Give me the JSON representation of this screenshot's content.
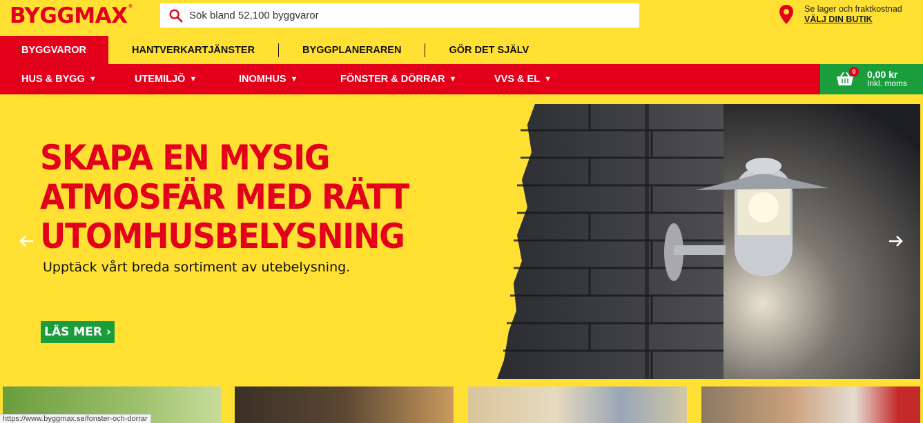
{
  "header": {
    "logo": "BYGGMAX",
    "search_placeholder": "Sök bland 52,100 byggvaror",
    "store": {
      "line1": "Se lager och fraktkostnad",
      "cta": "VÄLJ DIN BUTIK"
    }
  },
  "tabs": [
    "BYGGVAROR",
    "HANTVERKARTJÄNSTER",
    "BYGGPLANERAREN",
    "GÖR DET SJÄLV"
  ],
  "nav": {
    "items": [
      "HUS & BYGG",
      "UTEMILJÖ",
      "INOMHUS",
      "FÖNSTER & DÖRRAR",
      "VVS & EL"
    ],
    "cart": {
      "count": "0",
      "amount": "0,00 kr",
      "moms": "Inkl. moms"
    }
  },
  "hero": {
    "headline": [
      "SKAPA EN MYSIG",
      "ATMOSFÄR MED RÄTT",
      "UTOMHUSBELYSNING"
    ],
    "subtitle": "Upptäck vårt breda sortiment av utebelysning.",
    "cta": "LÄS MER ›"
  },
  "status_url": "https://www.byggmax.se/fonster-och-dorrar",
  "colors": {
    "yellow": "#ffe033",
    "red": "#e3001b",
    "green": "#1a9e3c"
  }
}
